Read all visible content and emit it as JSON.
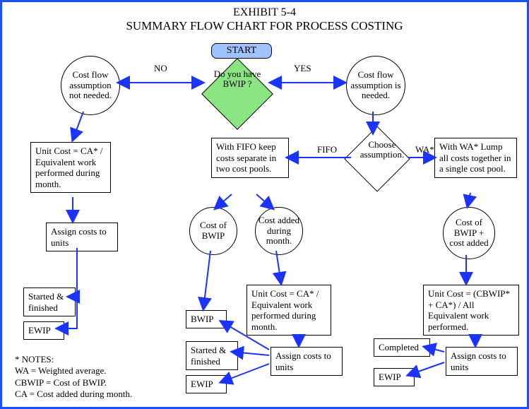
{
  "titles": {
    "line1": "EXHIBIT 5-4",
    "line2": "SUMMARY FLOW CHART FOR PROCESS COSTING"
  },
  "nodes": {
    "start": "START",
    "q_bwip": "Do you have BWIP ?",
    "choose": "Choose assumption.",
    "cf_not_needed": "Cost flow assumption not needed.",
    "cf_needed": "Cost flow assumption is needed.",
    "fifo_split": "With FIFO keep costs separate in two cost pools.",
    "cost_bwip": "Cost of BWIP",
    "cost_added": "Cost added during month.",
    "wa_lump": "With WA* Lump all costs together in a single cost pool.",
    "cost_bwip_plus": "Cost of BWIP + cost added",
    "uc_no_bwip": "Unit Cost = CA* / Equivalent work performed during month.",
    "uc_fifo": "Unit Cost = CA* / Equivalent work performed during month.",
    "uc_wa": "Unit Cost = (CBWIP* + CA*) / All Equivalent work performed.",
    "assign1": "Assign costs to units",
    "assign2": "Assign costs to units",
    "assign3": "Assign costs to units",
    "started_fin1": "Started & finished",
    "ewip1": "EWIP",
    "bwip_box": "BWIP",
    "started_fin2": "Started & finished",
    "ewip2": "EWIP",
    "completed": "Completed",
    "ewip3": "EWIP"
  },
  "edges": {
    "no": "NO",
    "yes": "YES",
    "fifo": "FIFO",
    "wa": "WA*"
  },
  "notes": {
    "title": "* NOTES:",
    "l1": "WA = Weighted average.",
    "l2": "CBWIP = Cost of BWIP.",
    "l3": "CA = Cost added during month."
  }
}
